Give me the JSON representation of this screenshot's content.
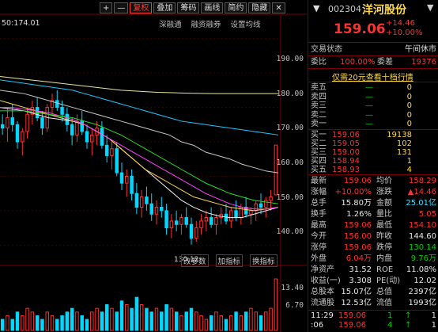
{
  "toolbar": {
    "plus": "+",
    "minus": "—",
    "period": "复权",
    "overlay": "叠加",
    "chips": "筹码",
    "draw": "画线",
    "simple": "简约",
    "hide": "隐藏",
    "close": "✕"
  },
  "subbar": {
    "a": "深融通",
    "b": "融资融券",
    "c": "设置均线"
  },
  "ma_label": "50:174.01",
  "axis": {
    "p190": "190.00",
    "p180": "180.00",
    "p170": "170.00",
    "p160": "160.00",
    "p150": "150.00",
    "p140": "140.00",
    "p130": "130.00",
    "low": "130.12",
    "v1": "13.40",
    "v2": "6.70"
  },
  "bottom_tabs": {
    "a": "改参数",
    "b": "加指标",
    "c": "换指标"
  },
  "stock": {
    "code": "002304",
    "name": "洋河股份",
    "price": "159.06",
    "change": "+14.46",
    "pct": "+10.00%"
  },
  "status": {
    "label": "交易状态",
    "value": "午间休市"
  },
  "ratio": {
    "wb_label": "委比",
    "wb_val": "100.00%",
    "wc_label": "委差",
    "wc_val": "19376"
  },
  "notice": "仅需20元查看十档行情",
  "sells": [
    {
      "label": "卖五",
      "price": "—",
      "vol": "0"
    },
    {
      "label": "卖四",
      "price": "—",
      "vol": "0"
    },
    {
      "label": "卖三",
      "price": "—",
      "vol": "0"
    },
    {
      "label": "卖二",
      "price": "—",
      "vol": "0"
    },
    {
      "label": "卖一",
      "price": "—",
      "vol": "0"
    }
  ],
  "buys": [
    {
      "label": "买一",
      "price": "159.06",
      "vol": "19138"
    },
    {
      "label": "买二",
      "price": "159.05",
      "vol": "102"
    },
    {
      "label": "买三",
      "price": "159.00",
      "vol": "131"
    },
    {
      "label": "买四",
      "price": "158.94",
      "vol": "1"
    },
    {
      "label": "买五",
      "price": "158.93",
      "vol": "4"
    }
  ],
  "stats": [
    {
      "l1": "最新",
      "v1": "159.06",
      "c1": "red",
      "l2": "均价",
      "v2": "158.29",
      "c2": "red"
    },
    {
      "l1": "涨幅",
      "v1": "+10.00%",
      "c1": "red",
      "l2": "涨跌",
      "v2": "▲14.46",
      "c2": "red"
    },
    {
      "l1": "总手",
      "v1": "15.80万",
      "c1": "white",
      "l2": "金额",
      "v2": "25.01亿",
      "c2": "cyan"
    },
    {
      "l1": "换手",
      "v1": "1.26%",
      "c1": "white",
      "l2": "量比",
      "v2": "5.05",
      "c2": "red"
    },
    {
      "l1": "最高",
      "v1": "159.06",
      "c1": "red",
      "l2": "最低",
      "v2": "154.10",
      "c2": "red"
    },
    {
      "l1": "今开",
      "v1": "156.00",
      "c1": "red",
      "l2": "昨收",
      "v2": "144.60",
      "c2": "white"
    },
    {
      "l1": "涨停",
      "v1": "159.06",
      "c1": "red",
      "l2": "跌停",
      "v2": "130.14",
      "c2": "green"
    },
    {
      "l1": "外盘",
      "v1": "6.04万",
      "c1": "red",
      "l2": "内盘",
      "v2": "9.76万",
      "c2": "green"
    },
    {
      "l1": "净资产",
      "v1": "31.52",
      "c1": "white",
      "l2": "ROE",
      "v2": "11.08%",
      "c2": "white"
    },
    {
      "l1": "收益(一)",
      "v1": "3.308",
      "c1": "white",
      "l2": "PE(动)",
      "v2": "12.02",
      "c2": "white"
    },
    {
      "l1": "总股本",
      "v1": "15.07亿",
      "c1": "white",
      "l2": "总值",
      "v2": "2397亿",
      "c2": "white"
    },
    {
      "l1": "流通股",
      "v1": "12.53亿",
      "c1": "white",
      "l2": "流值",
      "v2": "1993亿",
      "c2": "white"
    }
  ],
  "ticks": [
    {
      "time": "11:29",
      "price": "159.06",
      "vol": "1",
      "dir": "↑",
      "n": "1"
    },
    {
      "time": ":06",
      "price": "159.06",
      "vol": "4",
      "dir": "↑",
      "n": "1"
    }
  ],
  "chart_data": {
    "type": "candlestick",
    "candles": [
      [
        165,
        168,
        162,
        164
      ],
      [
        164,
        170,
        160,
        167
      ],
      [
        167,
        171,
        163,
        165
      ],
      [
        165,
        166,
        158,
        160
      ],
      [
        160,
        164,
        156,
        163
      ],
      [
        163,
        170,
        161,
        168
      ],
      [
        168,
        172,
        165,
        170
      ],
      [
        170,
        173,
        166,
        167
      ],
      [
        167,
        169,
        162,
        164
      ],
      [
        164,
        171,
        163,
        170
      ],
      [
        170,
        174,
        168,
        172
      ],
      [
        172,
        175,
        169,
        170
      ],
      [
        170,
        172,
        166,
        168
      ],
      [
        168,
        170,
        163,
        165
      ],
      [
        165,
        167,
        159,
        162
      ],
      [
        162,
        168,
        160,
        166
      ],
      [
        166,
        169,
        162,
        163
      ],
      [
        163,
        165,
        158,
        160
      ],
      [
        160,
        164,
        156,
        162
      ],
      [
        162,
        166,
        159,
        164
      ],
      [
        164,
        166,
        158,
        159
      ],
      [
        159,
        162,
        154,
        156
      ],
      [
        156,
        160,
        152,
        158
      ],
      [
        158,
        160,
        150,
        151
      ],
      [
        151,
        154,
        146,
        148
      ],
      [
        148,
        152,
        144,
        150
      ],
      [
        150,
        152,
        143,
        145
      ],
      [
        145,
        148,
        139,
        141
      ],
      [
        141,
        146,
        138,
        144
      ],
      [
        144,
        147,
        140,
        142
      ],
      [
        142,
        145,
        137,
        139
      ],
      [
        139,
        143,
        136,
        141
      ],
      [
        141,
        144,
        138,
        140
      ],
      [
        140,
        142,
        133,
        135
      ],
      [
        135,
        139,
        132,
        137
      ],
      [
        137,
        140,
        134,
        136
      ],
      [
        136,
        139,
        133,
        138
      ],
      [
        138,
        141,
        135,
        136
      ],
      [
        136,
        138,
        130.12,
        132
      ],
      [
        132,
        137,
        131,
        135
      ],
      [
        135,
        139,
        133,
        137
      ],
      [
        137,
        140,
        134,
        138
      ],
      [
        138,
        141,
        135,
        136
      ],
      [
        136,
        139,
        133,
        138
      ],
      [
        138,
        141,
        136,
        139
      ],
      [
        139,
        142,
        136,
        137
      ],
      [
        137,
        141,
        135,
        140
      ],
      [
        140,
        143,
        137,
        138
      ],
      [
        138,
        142,
        136,
        141
      ],
      [
        141,
        144,
        138,
        139
      ],
      [
        139,
        141,
        136,
        140
      ],
      [
        140,
        143,
        137,
        142
      ],
      [
        142,
        145,
        139,
        141
      ],
      [
        141,
        144,
        138,
        143
      ],
      [
        143,
        146,
        140,
        144
      ],
      [
        144.6,
        159.06,
        154.1,
        159.06
      ]
    ],
    "ma": [
      {
        "color": "#f0f0f0",
        "values": [
          170,
          169.5,
          169,
          168,
          167,
          166.5,
          166,
          165,
          163,
          161,
          158,
          155,
          152,
          149,
          146,
          143,
          141,
          139.5,
          138.5,
          138,
          138,
          139,
          140,
          141
        ]
      },
      {
        "color": "#ffd84a",
        "values": [
          172,
          171,
          170,
          169,
          168,
          167,
          166,
          165,
          163,
          161,
          158,
          155,
          152,
          150,
          148,
          146,
          144,
          143,
          142,
          141,
          140.5,
          140,
          140.5,
          141
        ]
      },
      {
        "color": "#ff40ff",
        "values": [
          170,
          170,
          169.5,
          169,
          168.5,
          167.5,
          166.5,
          165,
          163,
          161,
          159,
          157,
          155,
          153,
          151,
          149,
          147,
          145,
          143.5,
          142,
          141,
          140.5,
          140.5,
          141
        ]
      },
      {
        "color": "#22e022",
        "values": [
          169,
          169,
          169,
          168.5,
          168,
          167.5,
          167,
          166,
          165,
          163.5,
          162,
          160,
          158,
          156,
          154,
          152,
          150,
          148,
          146.5,
          145,
          144,
          143,
          142.5,
          142
        ]
      },
      {
        "color": "#c8c8c8",
        "values": [
          175,
          174.5,
          174,
          173,
          172,
          171,
          170,
          169,
          168,
          167,
          166,
          165,
          164,
          163,
          162,
          160,
          159,
          157,
          156,
          155,
          153.5,
          152.5,
          151.5,
          151
        ]
      },
      {
        "color": "#1fc8ff",
        "values": [
          178,
          177.5,
          177,
          176.5,
          176,
          175.5,
          175,
          174,
          173,
          172,
          171,
          170,
          169,
          168,
          167,
          166,
          165.5,
          165,
          164.5,
          164,
          163.5,
          163,
          162.5,
          162
        ]
      },
      {
        "color": "#e6e6a0",
        "values": [
          179,
          178.6,
          178.2,
          177.8,
          177.4,
          177,
          176.6,
          176.2,
          175.8,
          175.4,
          175,
          174.8,
          174.6,
          174.4,
          174.3,
          174.2,
          174.1,
          174.05,
          174.02,
          174.01,
          174.01,
          174.01,
          174.01,
          174.01
        ]
      }
    ],
    "volume": [
      3,
      4,
      3,
      5,
      4,
      6,
      5,
      4,
      3,
      5,
      4,
      3,
      4,
      5,
      6,
      5,
      4,
      3,
      5,
      6,
      5,
      7,
      6,
      5,
      8,
      7,
      6,
      9,
      7,
      6,
      5,
      6,
      5,
      7,
      6,
      5,
      4,
      5,
      6,
      5,
      4,
      3,
      4,
      5,
      4,
      3,
      4,
      5,
      4,
      5,
      6,
      5,
      4,
      5,
      6,
      14
    ],
    "ylim": [
      128,
      192
    ],
    "vol_ylim": [
      0,
      14
    ]
  }
}
